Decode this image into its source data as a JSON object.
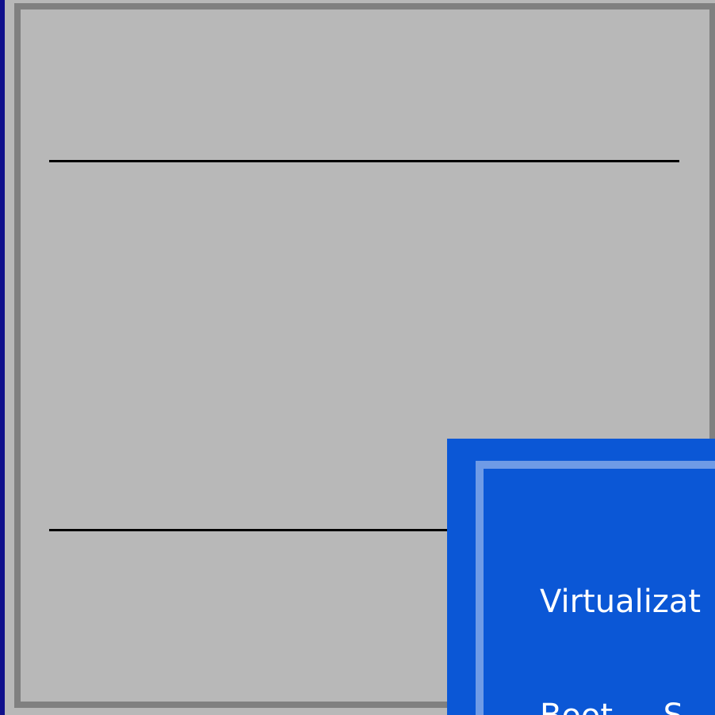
{
  "dialog": {
    "items": [
      {
        "label": "Virtualizat"
      },
      {
        "label": "Boot ... S"
      }
    ]
  },
  "colors": {
    "background": "#0b0b9e",
    "panel": "#b8b8b8",
    "frame": "#808080",
    "dialog": "#0b57d6",
    "dialog_border": "#6f9be6",
    "text": "#ffffff"
  }
}
